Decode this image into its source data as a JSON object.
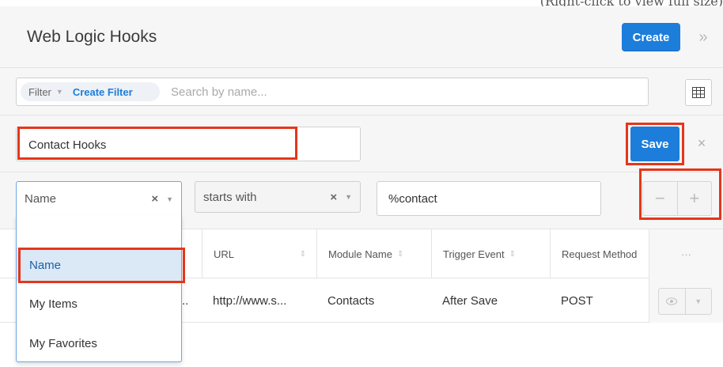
{
  "top_clipped_text": "(Right-click to view full size)",
  "header": {
    "title": "Web Logic Hooks",
    "create_label": "Create",
    "collapse_icon": "»"
  },
  "filter": {
    "filter_label": "Filter",
    "create_filter_label": "Create Filter",
    "search_placeholder": "Search by name..."
  },
  "name_row": {
    "name_value": "Contact Hooks",
    "save_label": "Save",
    "close_icon": "×"
  },
  "condition": {
    "field_value": "Name",
    "operator_value": "starts with",
    "value": "%contact",
    "minus": "−",
    "plus": "+"
  },
  "table": {
    "headers": [
      "URL",
      "Module Name",
      "Trigger Event",
      "Request Method"
    ],
    "actions_header": "···",
    "row": {
      "name_truncated": "..",
      "url": "http://www.s...",
      "module": "Contacts",
      "trigger": "After Save",
      "method": "POST"
    }
  },
  "dropdown": {
    "options": [
      "Name",
      "My Items",
      "My Favorites"
    ],
    "selected": "Name"
  },
  "colors": {
    "accent": "#1c7ddb",
    "highlight": "#e5361b",
    "selected_bg": "#dbe9f7"
  }
}
